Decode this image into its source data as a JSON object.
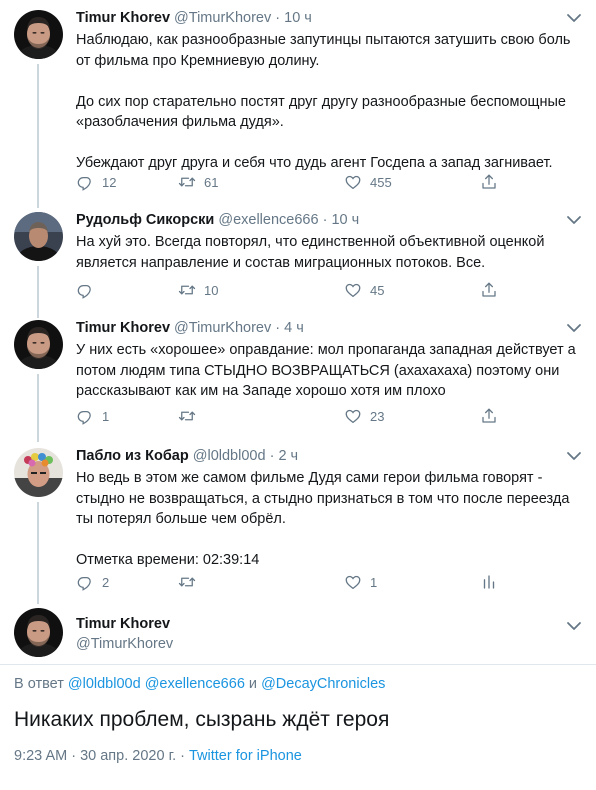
{
  "tweets": [
    {
      "name": "Timur Khorev",
      "handle": "@TimurKhorev",
      "time": "10 ч",
      "text": "Наблюдаю, как разнообразные запутинцы пытаются затушить свою боль\nот фильма про Кремниевую долину.\n\nДо сих пор старательно постят друг другу разнообразные беспомощные\n«разоблачения фильма дудя».\n\nУбеждают друг друга и себя что дудь агент Госдепа а запад загнивает.",
      "replies": "12",
      "retweets": "61",
      "likes": "455"
    },
    {
      "name": "Рудольф Сикорски",
      "handle": "@exellence666",
      "time": "10 ч",
      "text": "На хуй это. Всегда повторял, что единственной объективной оценкой\nявляется направление и состав миграционных потоков. Все.",
      "replies": "",
      "retweets": "10",
      "likes": "45"
    },
    {
      "name": "Timur Khorev",
      "handle": "@TimurKhorev",
      "time": "4 ч",
      "text": "У них есть «хорошее» оправдание: мол пропаганда западная действует а\nпотом людям типа СТЫДНО ВОЗВРАЩАТЬСЯ (ахахахаха) поэтому они\nрассказывают как им на Западе хорошо хотя им плохо",
      "replies": "1",
      "retweets": "",
      "likes": "23"
    },
    {
      "name": "Пабло из Кобар",
      "handle": "@l0ldbl00d",
      "time": "2 ч",
      "text": "Но ведь в этом же самом фильме Дудя сами герои фильма говорят -\nстыдно не возвращаться, а стыдно признаться в том что после переезда\nты потерял больше чем обрёл.\n\nОтметка времени: 02:39:14",
      "replies": "2",
      "retweets": "",
      "likes": "1"
    }
  ],
  "main": {
    "name": "Timur Khorev",
    "handle": "@TimurKhorev",
    "reply_prefix": "В ответ",
    "mention1": "@l0ldbl00d",
    "mention2": "@exellence666",
    "conj": "и",
    "mention3": "@DecayChronicles",
    "text": "Никаких проблем, сызрань ждёт героя",
    "datetime": "9:23 AM · 30 апр. 2020 г. · ",
    "client": "Twitter for iPhone"
  },
  "colors": {
    "accent": "#1b95e0",
    "muted": "#657786",
    "text": "#14171a",
    "thread_line": "#ccd6dd",
    "divider": "#e1e8ed"
  },
  "icons": [
    "reply-icon",
    "retweet-icon",
    "like-icon",
    "share-icon",
    "chevron-down-icon"
  ]
}
